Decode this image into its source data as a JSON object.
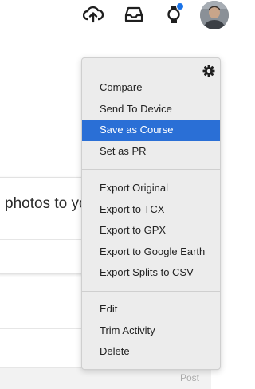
{
  "header": {
    "upload_icon": "cloud-upload-icon",
    "inbox_icon": "inbox-tray-icon",
    "watch_icon": "watch-icon",
    "notification_color": "#1a73e8"
  },
  "background": {
    "photos_text": "photos to yo",
    "post_label": "Post"
  },
  "menu": {
    "gear_icon": "gear-icon",
    "groups": [
      {
        "items": [
          "Compare",
          "Send To Device",
          "Save as Course",
          "Set as PR"
        ]
      },
      {
        "items": [
          "Export Original",
          "Export to TCX",
          "Export to GPX",
          "Export to Google Earth",
          "Export Splits to CSV"
        ]
      },
      {
        "items": [
          "Edit",
          "Trim Activity",
          "Delete"
        ]
      }
    ],
    "active_item": "Save as Course",
    "active_color": "#2a6fd6"
  }
}
